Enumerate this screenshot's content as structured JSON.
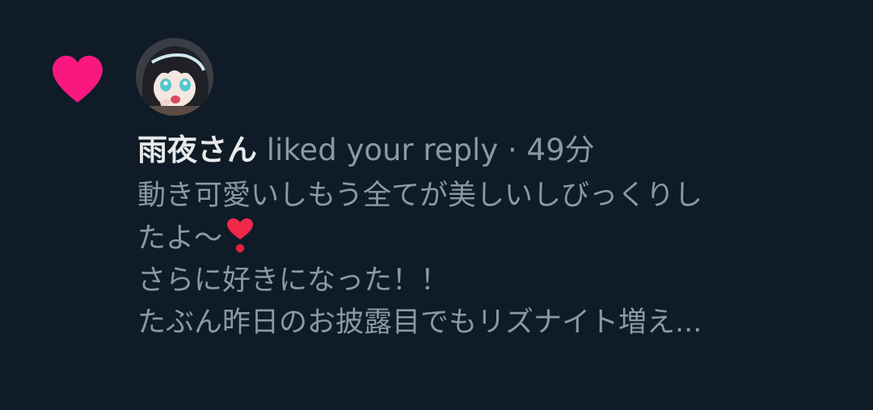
{
  "notification": {
    "icon": "heart-icon",
    "accent_color": "#f91880",
    "user_name": "雨夜さん",
    "action_text": "liked your reply",
    "separator": "·",
    "timestamp": "49分",
    "preview_lines": [
      "動き可愛いしもう全てが美しいしびっくりし",
      "たよ〜",
      "さらに好きになった！！",
      "たぶん昨日のお披露目でもリズナイト増え..."
    ],
    "preview_emoji": "heart-exclamation-emoji"
  }
}
